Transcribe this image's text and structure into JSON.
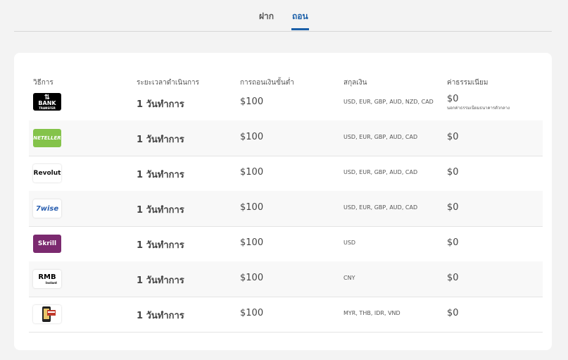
{
  "tabs": [
    {
      "label": "ฝาก"
    },
    {
      "label": "ถอน",
      "active": true
    }
  ],
  "table": {
    "headers": [
      "วิธีการ",
      "ระยะเวลาดำเนินการ",
      "การถอนเงินขั้นต่ำ",
      "สกุลเงิน",
      "ค่าธรรมเนียม"
    ],
    "rows": [
      {
        "method": "BANK TRANSFER",
        "logo_text": "BANK",
        "logo_sub": "TRANSFER",
        "time": "1 วันทำการ",
        "min": "$100",
        "currencies": "USD, EUR, GBP, AUD, NZD, CAD",
        "fee": "$0",
        "fee_note": "นอกค่าธรรมเนียมธนาคารตัวกลาง"
      },
      {
        "method": "NETELLER",
        "logo_text": "NETELLER",
        "time": "1 วันทำการ",
        "min": "$100",
        "currencies": "USD, EUR, GBP, AUD, CAD",
        "fee": "$0"
      },
      {
        "method": "Revolut",
        "logo_text": "Revolut",
        "time": "1 วันทำการ",
        "min": "$100",
        "currencies": "USD, EUR, GBP, AUD, CAD",
        "fee": "$0"
      },
      {
        "method": "wise",
        "logo_text": "7wise",
        "time": "1 วันทำการ",
        "min": "$100",
        "currencies": "USD, EUR, GBP, AUD, CAD",
        "fee": "$0"
      },
      {
        "method": "Skrill",
        "logo_text": "Skrill",
        "time": "1 วันทำการ",
        "min": "$100",
        "currencies": "USD",
        "fee": "$0"
      },
      {
        "method": "RMB Instant",
        "logo_text": "RMB",
        "logo_sub": "Instant",
        "time": "1 วันทำการ",
        "min": "$100",
        "currencies": "CNY",
        "fee": "$0"
      },
      {
        "method": "Mobile banking",
        "time": "1 วันทำการ",
        "min": "$100",
        "currencies": "MYR, THB, IDR, VND",
        "fee": "$0"
      }
    ]
  },
  "colors": {
    "accent": "#1a5fa8",
    "neteller": "#84c34a",
    "skrill": "#7b2a6f"
  },
  "icons": [
    "bank-transfer-logo",
    "neteller-logo",
    "revolut-logo",
    "wise-logo",
    "skrill-logo",
    "rmb-instant-logo",
    "mobile-banking-logo"
  ]
}
